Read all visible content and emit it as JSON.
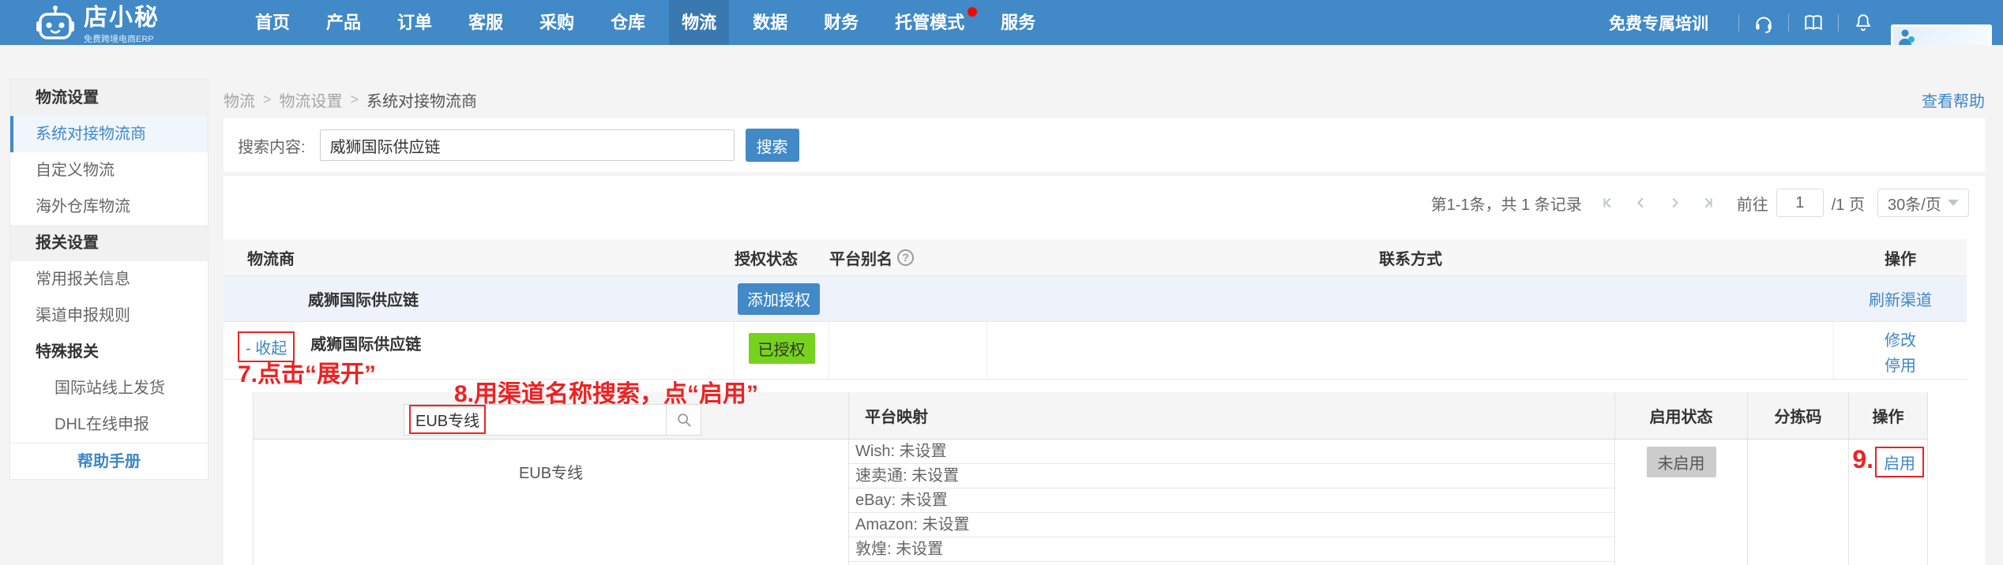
{
  "navbar": {
    "brand": {
      "name": "店小秘",
      "tagline": "免费跨境电商ERP"
    },
    "menu": [
      {
        "label": "首页"
      },
      {
        "label": "产品"
      },
      {
        "label": "订单"
      },
      {
        "label": "客服"
      },
      {
        "label": "采购"
      },
      {
        "label": "仓库"
      },
      {
        "label": "物流",
        "active": true
      },
      {
        "label": "数据"
      },
      {
        "label": "财务"
      },
      {
        "label": "托管模式",
        "badge": true
      },
      {
        "label": "服务"
      }
    ],
    "training": "免费专属培训"
  },
  "sidebar": {
    "items": [
      {
        "label": "物流设置",
        "type": "header"
      },
      {
        "label": "系统对接物流商",
        "type": "item",
        "active": true
      },
      {
        "label": "自定义物流",
        "type": "item"
      },
      {
        "label": "海外仓库物流",
        "type": "item"
      },
      {
        "label": "报关设置",
        "type": "header"
      },
      {
        "label": "常用报关信息",
        "type": "item"
      },
      {
        "label": "渠道申报规则",
        "type": "item"
      },
      {
        "label": "特殊报关",
        "type": "subheader"
      },
      {
        "label": "国际站线上发货",
        "type": "subitem"
      },
      {
        "label": "DHL在线申报",
        "type": "subitem"
      },
      {
        "label": "帮助手册",
        "type": "footer-link"
      }
    ]
  },
  "breadcrumb": {
    "items": [
      "物流",
      "物流设置",
      "系统对接物流商"
    ],
    "help": "查看帮助"
  },
  "search_panel": {
    "label": "搜索内容:",
    "value": "威狮国际供应链",
    "button": "搜索"
  },
  "pagination": {
    "summary": "第1-1条，共 1 条记录",
    "goto_label": "前往",
    "page_value": "1",
    "page_suffix": "/1 页",
    "page_size": "30条/页"
  },
  "table": {
    "headers": [
      "物流商",
      "授权状态",
      "平台别名",
      "联系方式",
      "操作"
    ],
    "row1": {
      "name": "威狮国际供应链",
      "add_auth": "添加授权",
      "refresh": "刷新渠道"
    },
    "row2": {
      "collapse": "- 收起",
      "name": "威狮国际供应链",
      "status": "已授权",
      "modify": "修改",
      "disable": "停用"
    }
  },
  "subtable": {
    "search_value": "EUB专线",
    "headers": [
      "平台映射",
      "启用状态",
      "分拣码",
      "操作"
    ],
    "row": {
      "channel": "EUB专线",
      "platforms": [
        {
          "text": "Wish: 未设置"
        },
        {
          "text": "速卖通: 未设置"
        },
        {
          "text": "eBay: 未设置"
        },
        {
          "text": "Amazon: 未设置"
        },
        {
          "text": "敦煌: 未设置"
        }
      ],
      "status": "未启用",
      "action": "启用"
    }
  },
  "annotations": {
    "step7": "7.点击“展开”",
    "step8": "8.用渠道名称搜索，点“启用”",
    "step9": "9."
  },
  "icons": {
    "question": "?"
  },
  "colors": {
    "navbar": "#4189c7",
    "link_blue": "#3e86c5",
    "authorized_green": "#76d21d",
    "annotation_red": "#ee2222",
    "disabled_gray": "#cccccc"
  }
}
